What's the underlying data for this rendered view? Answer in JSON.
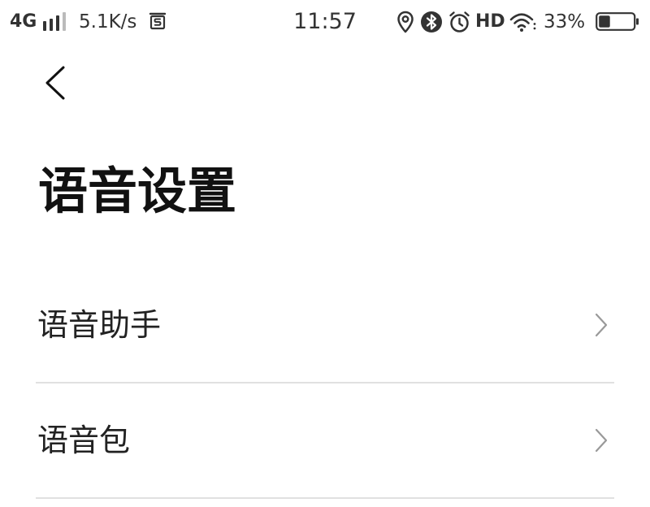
{
  "status_bar": {
    "network_type": "4G",
    "signal_bars": 3,
    "network_speed": "5.1K/s",
    "time": "11:57",
    "hd_label": "HD",
    "battery_text": "33%",
    "battery_level": 0.33,
    "icons": {
      "signal": "signal-bars-icon",
      "notification": "app-notification-icon",
      "location": "location-pin-icon",
      "bluetooth": "bluetooth-icon",
      "alarm": "alarm-clock-icon",
      "wifi": "wifi-icon",
      "battery": "battery-icon"
    }
  },
  "header": {
    "back_icon": "chevron-left-icon",
    "title": "语音设置"
  },
  "settings_list": {
    "items": [
      {
        "label": "语音助手",
        "icon": "chevron-right-icon"
      },
      {
        "label": "语音包",
        "icon": "chevron-right-icon"
      }
    ]
  },
  "colors": {
    "background": "#ffffff",
    "title_text": "#111111",
    "item_text": "#222222",
    "status_text": "#333333",
    "chevron": "#999999",
    "divider": "#e0e0e0",
    "signal_inactive": "#bbbbbb"
  }
}
